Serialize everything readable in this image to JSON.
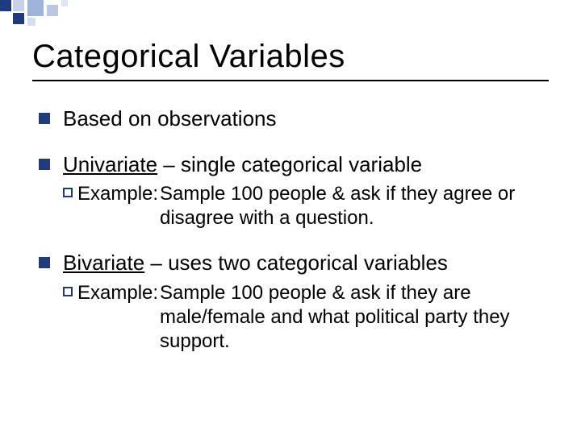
{
  "title": "Categorical Variables",
  "bullets": [
    {
      "text": "Based on observations"
    },
    {
      "term": "Univariate",
      "rest": " – single categorical variable",
      "example_label": "Example:",
      "example_text": "Sample 100 people & ask if they agree or disagree with a question."
    },
    {
      "term": "Bivariate",
      "rest": " – uses two categorical variables",
      "example_label": "Example:",
      "example_text": "Sample 100 people & ask if they are male/female and what political party they support."
    }
  ]
}
